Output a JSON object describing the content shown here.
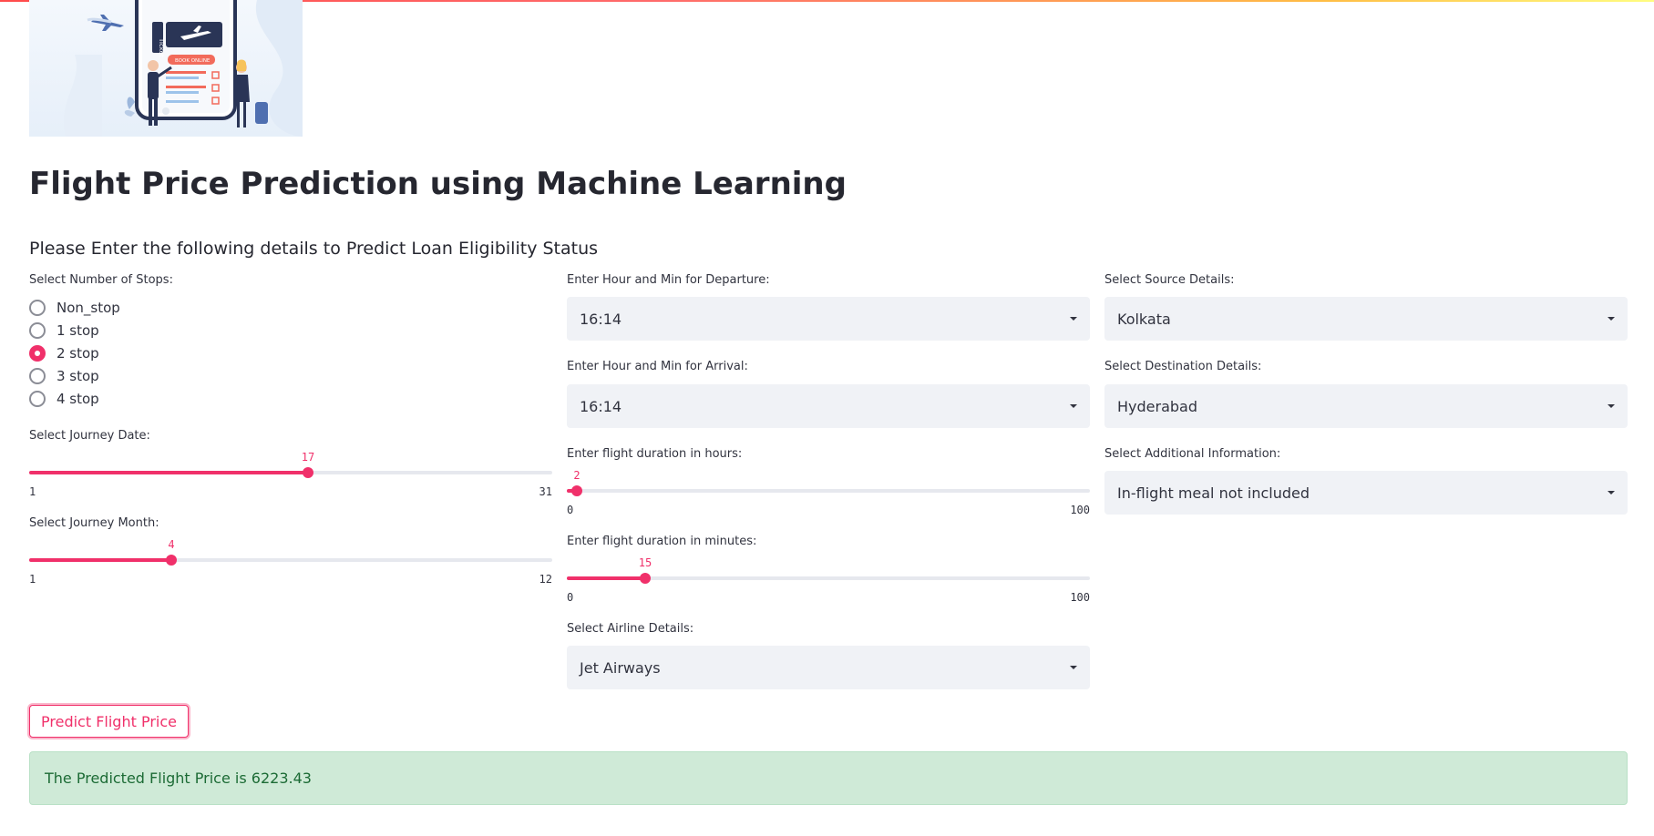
{
  "page": {
    "title": "Flight Price Prediction using Machine Learning",
    "subtitle": "Please Enter the following details to Predict Loan Eligibility Status"
  },
  "hero": {
    "ticket_text": "Ticket",
    "book_online_text": "BOOK ONLINE"
  },
  "stops": {
    "label": "Select Number of Stops:",
    "options": [
      "Non_stop",
      "1 stop",
      "2 stop",
      "3 stop",
      "4 stop"
    ],
    "selected": "2 stop"
  },
  "journey_date": {
    "label": "Select Journey Date:",
    "value": "17",
    "min": "1",
    "max": "31"
  },
  "journey_month": {
    "label": "Select Journey Month:",
    "value": "4",
    "min": "1",
    "max": "12"
  },
  "departure": {
    "label": "Enter Hour and Min for Departure:",
    "value": "16:14"
  },
  "arrival": {
    "label": "Enter Hour and Min for Arrival:",
    "value": "16:14"
  },
  "duration_hours": {
    "label": "Enter flight duration in hours:",
    "value": "2",
    "min": "0",
    "max": "100"
  },
  "duration_minutes": {
    "label": "Enter flight duration in minutes:",
    "value": "15",
    "min": "0",
    "max": "100"
  },
  "airline": {
    "label": "Select Airline Details:",
    "value": "Jet Airways"
  },
  "source": {
    "label": "Select Source Details:",
    "value": "Kolkata"
  },
  "destination": {
    "label": "Select Destination Details:",
    "value": "Hyderabad"
  },
  "additional_info": {
    "label": "Select Additional Information:",
    "value": "In-flight meal not included"
  },
  "predict_button": {
    "label": "Predict Flight Price"
  },
  "result": {
    "text": "The Predicted Flight Price is 6223.43"
  },
  "colors": {
    "accent": "#f0306a",
    "success_bg": "#cfead7",
    "success_text": "#1c6b35",
    "select_bg": "#f0f2f6"
  }
}
